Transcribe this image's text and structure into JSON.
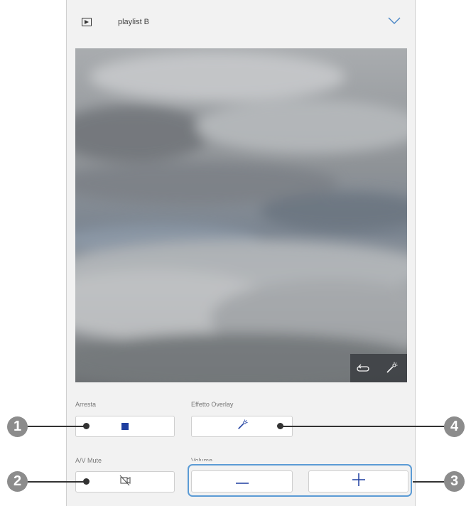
{
  "header": {
    "playlist_name": "playlist B"
  },
  "controls": {
    "stop_label": "Arresta",
    "overlay_label": "Effetto Overlay",
    "mute_label": "A/V Mute",
    "volume_label": "Volume"
  },
  "callouts": [
    "1",
    "2",
    "3",
    "4"
  ],
  "colors": {
    "highlight": "#5b9bd5",
    "callout": "#8c8c8c"
  }
}
